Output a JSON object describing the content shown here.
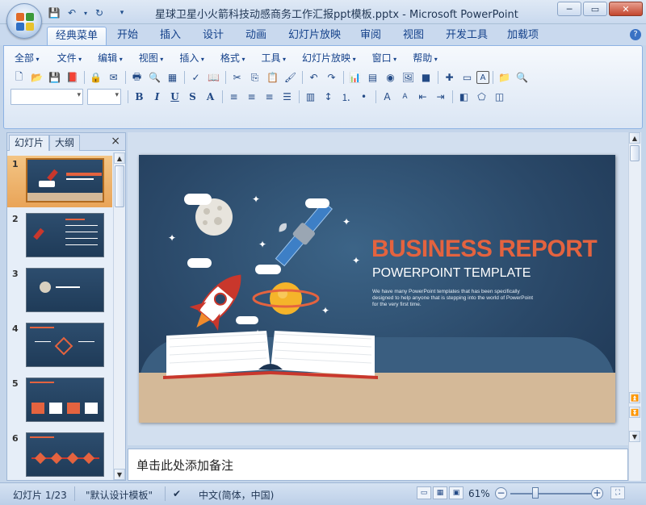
{
  "window": {
    "title": "星球卫星小火箭科技动感商务工作汇报ppt模板.pptx - Microsoft PowerPoint",
    "controls": [
      "minimize",
      "maximize",
      "close"
    ]
  },
  "quick_access": [
    "save-icon",
    "undo-icon",
    "redo-icon",
    "customize-icon"
  ],
  "tabs": [
    {
      "label": "经典菜单",
      "active": true
    },
    {
      "label": "开始"
    },
    {
      "label": "插入"
    },
    {
      "label": "设计"
    },
    {
      "label": "动画"
    },
    {
      "label": "幻灯片放映"
    },
    {
      "label": "审阅"
    },
    {
      "label": "视图"
    },
    {
      "label": "开发工具"
    },
    {
      "label": "加载项"
    }
  ],
  "menus": [
    "全部",
    "文件",
    "编辑",
    "视图",
    "插入",
    "格式",
    "工具",
    "幻灯片放映",
    "窗口",
    "帮助"
  ],
  "format_buttons": [
    "B",
    "I",
    "U",
    "S",
    "A"
  ],
  "left_pane": {
    "tabs": [
      "幻灯片",
      "大纲"
    ],
    "close": "×",
    "slides": [
      {
        "num": "1",
        "selected": true
      },
      {
        "num": "2"
      },
      {
        "num": "3"
      },
      {
        "num": "4"
      },
      {
        "num": "5"
      },
      {
        "num": "6"
      }
    ]
  },
  "slide": {
    "title": "BUSINESS REPORT",
    "subtitle": "POWERPOINT TEMPLATE",
    "body": "We have many PowerPoint templates that has been specifically designed to help anyone that is stepping into the world of PowerPoint for the very first time.",
    "colors": {
      "title": "#e4633f",
      "background": "#2a4868",
      "ground": "#d4b998"
    }
  },
  "notes": {
    "placeholder": "单击此处添加备注"
  },
  "status": {
    "slide_count": "幻灯片 1/23",
    "theme": "\"默认设计模板\"",
    "language": "中文(简体，中国)",
    "zoom": "61%",
    "zoom_fraction": 0.61
  }
}
